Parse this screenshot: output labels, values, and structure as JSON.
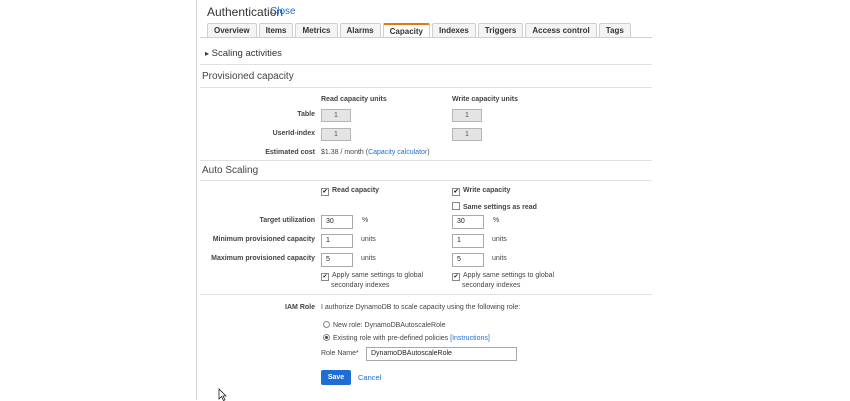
{
  "header": {
    "title": "Authentication",
    "close_label": "Close"
  },
  "tabs": [
    "Overview",
    "Items",
    "Metrics",
    "Alarms",
    "Capacity",
    "Indexes",
    "Triggers",
    "Access control",
    "Tags"
  ],
  "active_tab": "Capacity",
  "scaling_activities": {
    "arrow": "▸",
    "label": "Scaling activities"
  },
  "provisioned": {
    "heading": "Provisioned capacity",
    "read_header": "Read capacity units",
    "write_header": "Write capacity units",
    "rows": [
      {
        "label": "Table",
        "read": "1",
        "write": "1"
      },
      {
        "label": "UserId-index",
        "read": "1",
        "write": "1"
      }
    ],
    "estimated_cost_label": "Estimated cost",
    "estimated_cost_value": "$1.38 / month (",
    "calculator_link": "Capacity calculator",
    "calculator_close": ")"
  },
  "auto_scaling": {
    "heading": "Auto Scaling",
    "read_capacity_label": "Read capacity",
    "write_capacity_label": "Write capacity",
    "same_settings_label": "Same settings as read",
    "target_label": "Target utilization",
    "target_read": "30",
    "target_write": "30",
    "percent": "%",
    "min_label": "Minimum provisioned capacity",
    "min_read": "1",
    "min_write": "1",
    "max_label": "Maximum provisioned capacity",
    "max_read": "5",
    "max_write": "5",
    "units": "units",
    "apply_global_line1": "Apply same settings to global",
    "apply_global_line2": "secondary indexes"
  },
  "iam": {
    "label": "IAM Role",
    "description": "I authorize DynamoDB to scale capacity using the following role:",
    "new_role": "New role: DynamoDBAutoscaleRole",
    "existing_role": "Existing role with pre-defined policies",
    "instructions_link": "[Instructions]",
    "role_name_label": "Role Name*",
    "role_name_value": "DynamoDBAutoscaleRole"
  },
  "actions": {
    "save": "Save",
    "cancel": "Cancel"
  },
  "colors": {
    "accent_tab": "#e47911",
    "link": "#1f6ed4",
    "primary_button": "#1f6ed4"
  }
}
